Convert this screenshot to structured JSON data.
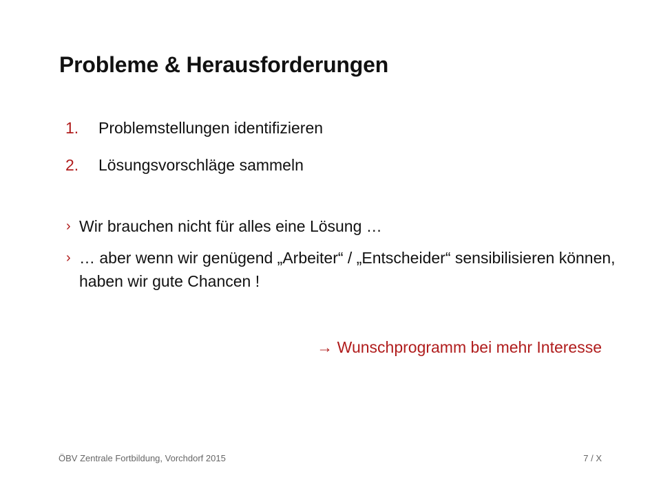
{
  "slide": {
    "title": "Probleme & Herausforderungen",
    "numbered_items": [
      {
        "number": "1.",
        "text": "Problemstellungen identifizieren"
      },
      {
        "number": "2.",
        "text": "Lösungsvorschläge sammeln"
      }
    ],
    "bullet_marker": "›",
    "bullets": [
      {
        "text": "Wir brauchen nicht für alles eine Lösung …"
      },
      {
        "text": "… aber wenn wir genügend „Arbeiter“ / „Entscheider“ sensibilisieren können, haben wir gute Chancen !"
      }
    ],
    "callout": "→ Wunschprogramm bei mehr Interesse",
    "footer_left": "ÖBV Zentrale Fortbildung, Vorchdorf 2015",
    "footer_right": "7 / X"
  },
  "colors": {
    "accent": "#b01c1c",
    "text": "#111111",
    "footer": "#666666"
  }
}
